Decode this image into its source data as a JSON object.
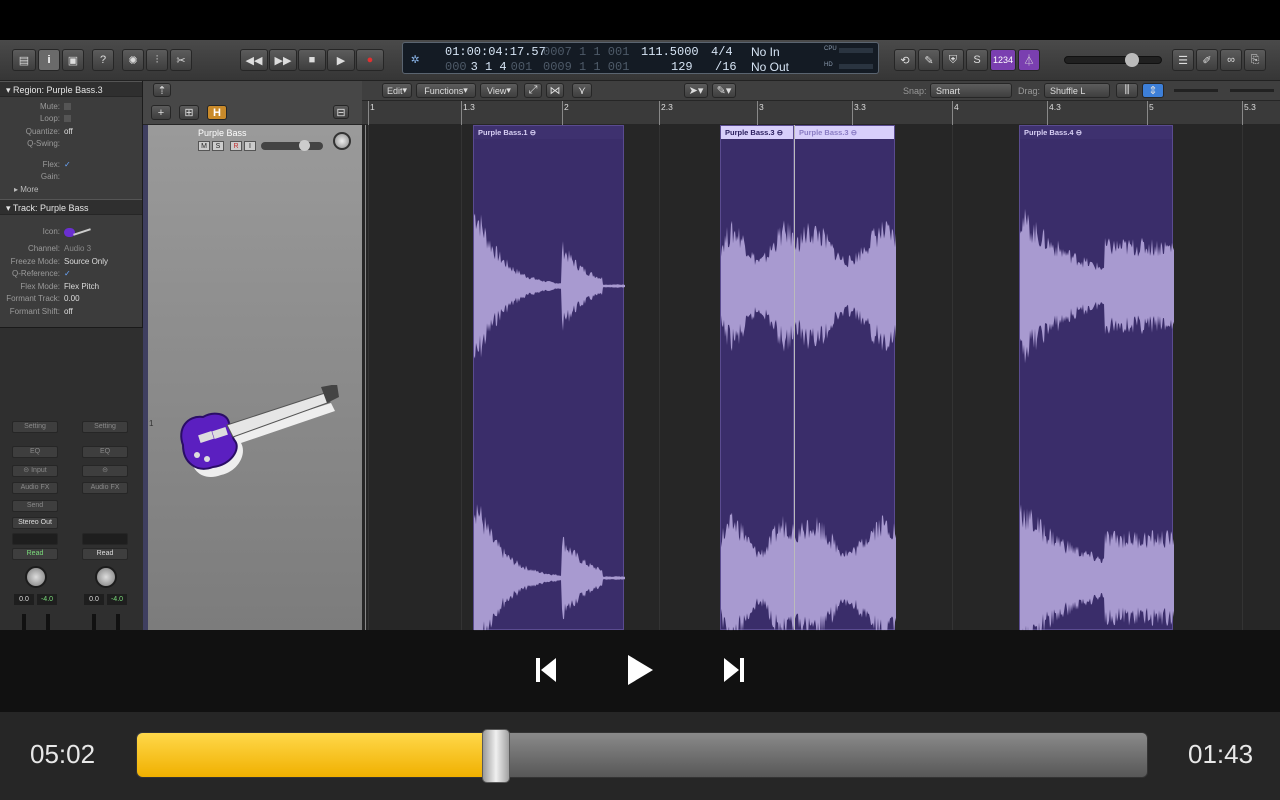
{
  "lcd": {
    "time": "01:00:04:17.57",
    "bars_top": "0007 1 1 001",
    "bars_main": "3 1 4",
    "bars_main_dim": "000",
    "bars_main_tail": "001",
    "bars_bottom": "0009 1 1 001",
    "tempo": "111.5000",
    "tempo_bpm": "129",
    "sig": "4/4",
    "div": "/16",
    "no_in": "No In",
    "no_out": "No Out",
    "cpu": "CPU",
    "hd": "HD"
  },
  "toolbar": {
    "lcd_badge": "1234"
  },
  "inspector": {
    "region_header": "Region: Purple Bass.3",
    "region_rows": [
      {
        "k": "Mute:",
        "v": ""
      },
      {
        "k": "Loop:",
        "v": ""
      },
      {
        "k": "Quantize:",
        "v": "off"
      },
      {
        "k": "Q-Swing:",
        "v": ""
      },
      {
        "k": "Flex:",
        "v": "✓"
      },
      {
        "k": "Gain:",
        "v": ""
      }
    ],
    "more": "More",
    "track_header": "Track:  Purple Bass",
    "icon_label": "Icon:",
    "track_rows": [
      {
        "k": "Channel:",
        "v": "Audio 3"
      },
      {
        "k": "Freeze Mode:",
        "v": "Source Only"
      },
      {
        "k": "Q-Reference:",
        "v": "✓"
      },
      {
        "k": "Flex Mode:",
        "v": "Flex Pitch"
      },
      {
        "k": "Formant Track:",
        "v": "0.00"
      },
      {
        "k": "Formant Shift:",
        "v": "off"
      }
    ]
  },
  "strips": {
    "left": {
      "setting": "Setting",
      "eq": "EQ",
      "input": "Input",
      "audio_fx": "Audio FX",
      "send": "Send",
      "output": "Stereo Out",
      "read": "Read",
      "vol": "0.0",
      "pan": "-4.0"
    },
    "right": {
      "setting": "Setting",
      "eq": "EQ",
      "audio_fx": "Audio FX",
      "read": "Read",
      "vol": "0.0",
      "pan": "-4.0"
    }
  },
  "tracklist": {
    "track_name": "Purple Bass",
    "track_number": "1",
    "m": "M",
    "s": "S",
    "r": "R",
    "i": "I",
    "h_button": "H"
  },
  "arrange": {
    "menu": {
      "edit": "Edit",
      "functions": "Functions",
      "view": "View"
    },
    "snap_label": "Snap:",
    "snap_value": "Smart",
    "drag_label": "Drag:",
    "drag_value": "Shuffle L",
    "ruler_labels": [
      "1",
      "1.3",
      "2",
      "2.3",
      "3",
      "3.3",
      "4",
      "4.3",
      "5",
      "5.3"
    ],
    "regions": [
      {
        "name": "Purple Bass.1"
      },
      {
        "name": "Purple Bass.3"
      },
      {
        "name": "Purple Bass.3"
      },
      {
        "name": "Purple Bass.4"
      }
    ]
  },
  "player": {
    "elapsed": "05:02",
    "remaining": "01:43",
    "progress": 0.355
  },
  "colors": {
    "accent": "#f5b800",
    "region": "#3a2d6a",
    "waveform": "#a89ad0",
    "selected_region_header": "#d8cffb"
  }
}
